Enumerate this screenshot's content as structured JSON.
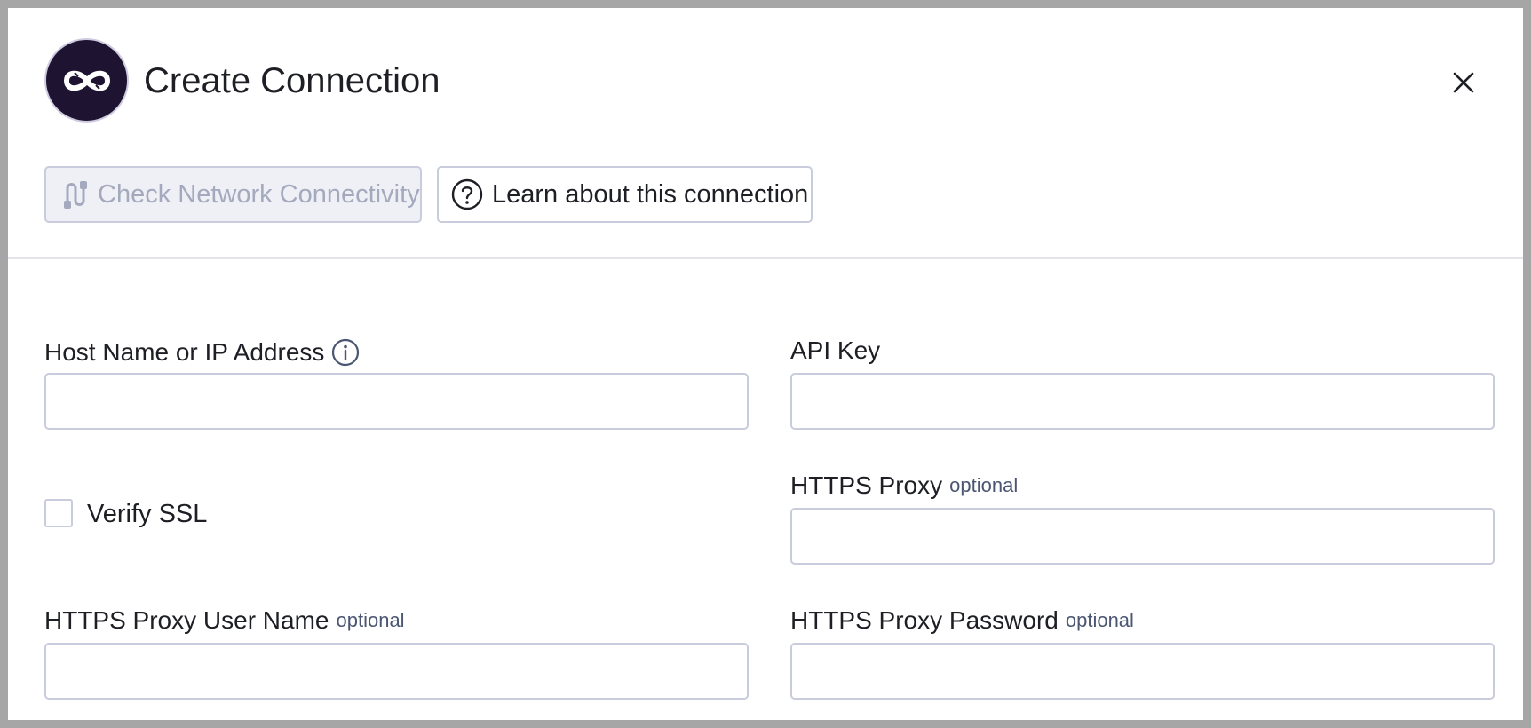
{
  "header": {
    "title": "Create Connection",
    "logo_icon": "infinity-logo-icon",
    "close_icon": "close-icon"
  },
  "toolbar": {
    "check_connectivity_label": "Check Network Connectivity",
    "check_connectivity_icon": "plug-icon",
    "check_connectivity_disabled": true,
    "learn_label": "Learn about this connection",
    "learn_icon": "question-circle-icon"
  },
  "form": {
    "host": {
      "label": "Host Name or IP Address",
      "info_icon": "info-icon",
      "value": ""
    },
    "api_key": {
      "label": "API Key",
      "value": ""
    },
    "verify_ssl": {
      "label": "Verify SSL",
      "checked": false
    },
    "https_proxy": {
      "label": "HTTPS Proxy",
      "optional": "optional",
      "value": ""
    },
    "proxy_user": {
      "label": "HTTPS Proxy User Name",
      "optional": "optional",
      "value": ""
    },
    "proxy_password": {
      "label": "HTTPS Proxy Password",
      "optional": "optional",
      "value": ""
    }
  },
  "colors": {
    "logo_bg": "#1e1330",
    "border": "#c9ccdc",
    "disabled_text": "#a4a9bd",
    "optional_text": "#4b5673"
  }
}
